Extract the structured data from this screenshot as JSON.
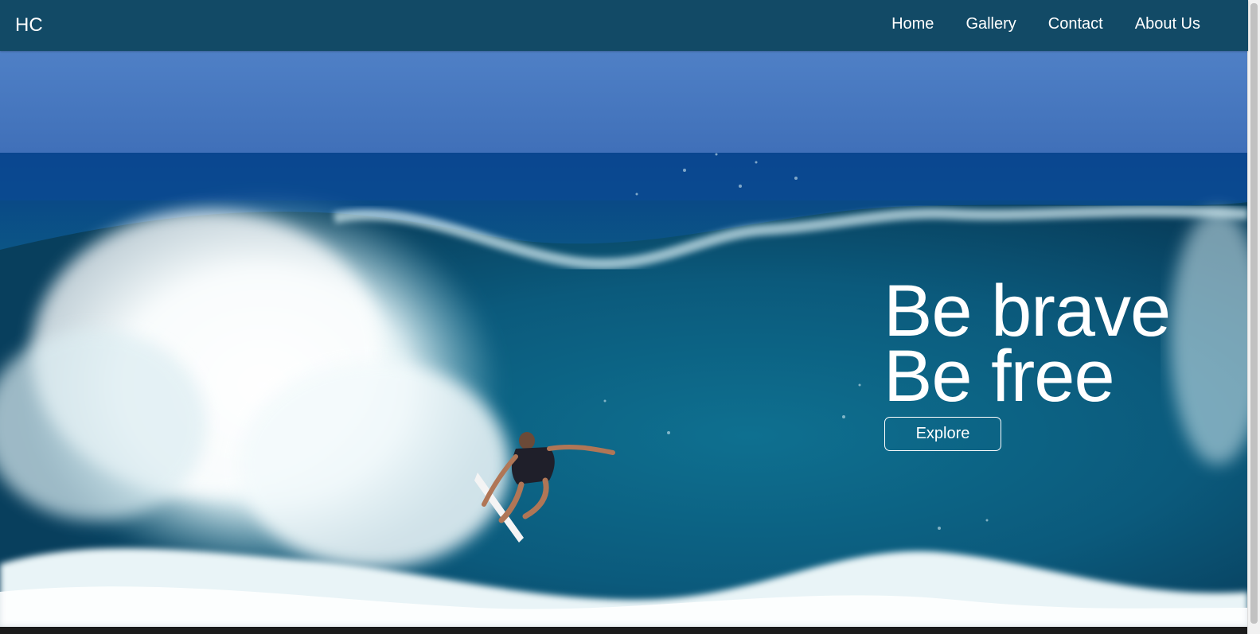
{
  "navbar": {
    "brand": "HC",
    "links": [
      {
        "label": "Home"
      },
      {
        "label": "Gallery"
      },
      {
        "label": "Contact"
      },
      {
        "label": "About Us"
      }
    ]
  },
  "hero": {
    "headline_line1": "Be brave",
    "headline_line2": "Be free",
    "cta_label": "Explore",
    "image_description_icon": "surfer-wave-photo"
  },
  "colors": {
    "navbar_bg": "#124a66",
    "sky": "#4a7cc0",
    "ocean_deep": "#0b4f74",
    "ocean_mid": "#0e6a8a",
    "foam": "#e8f3f7",
    "text": "#ffffff"
  }
}
